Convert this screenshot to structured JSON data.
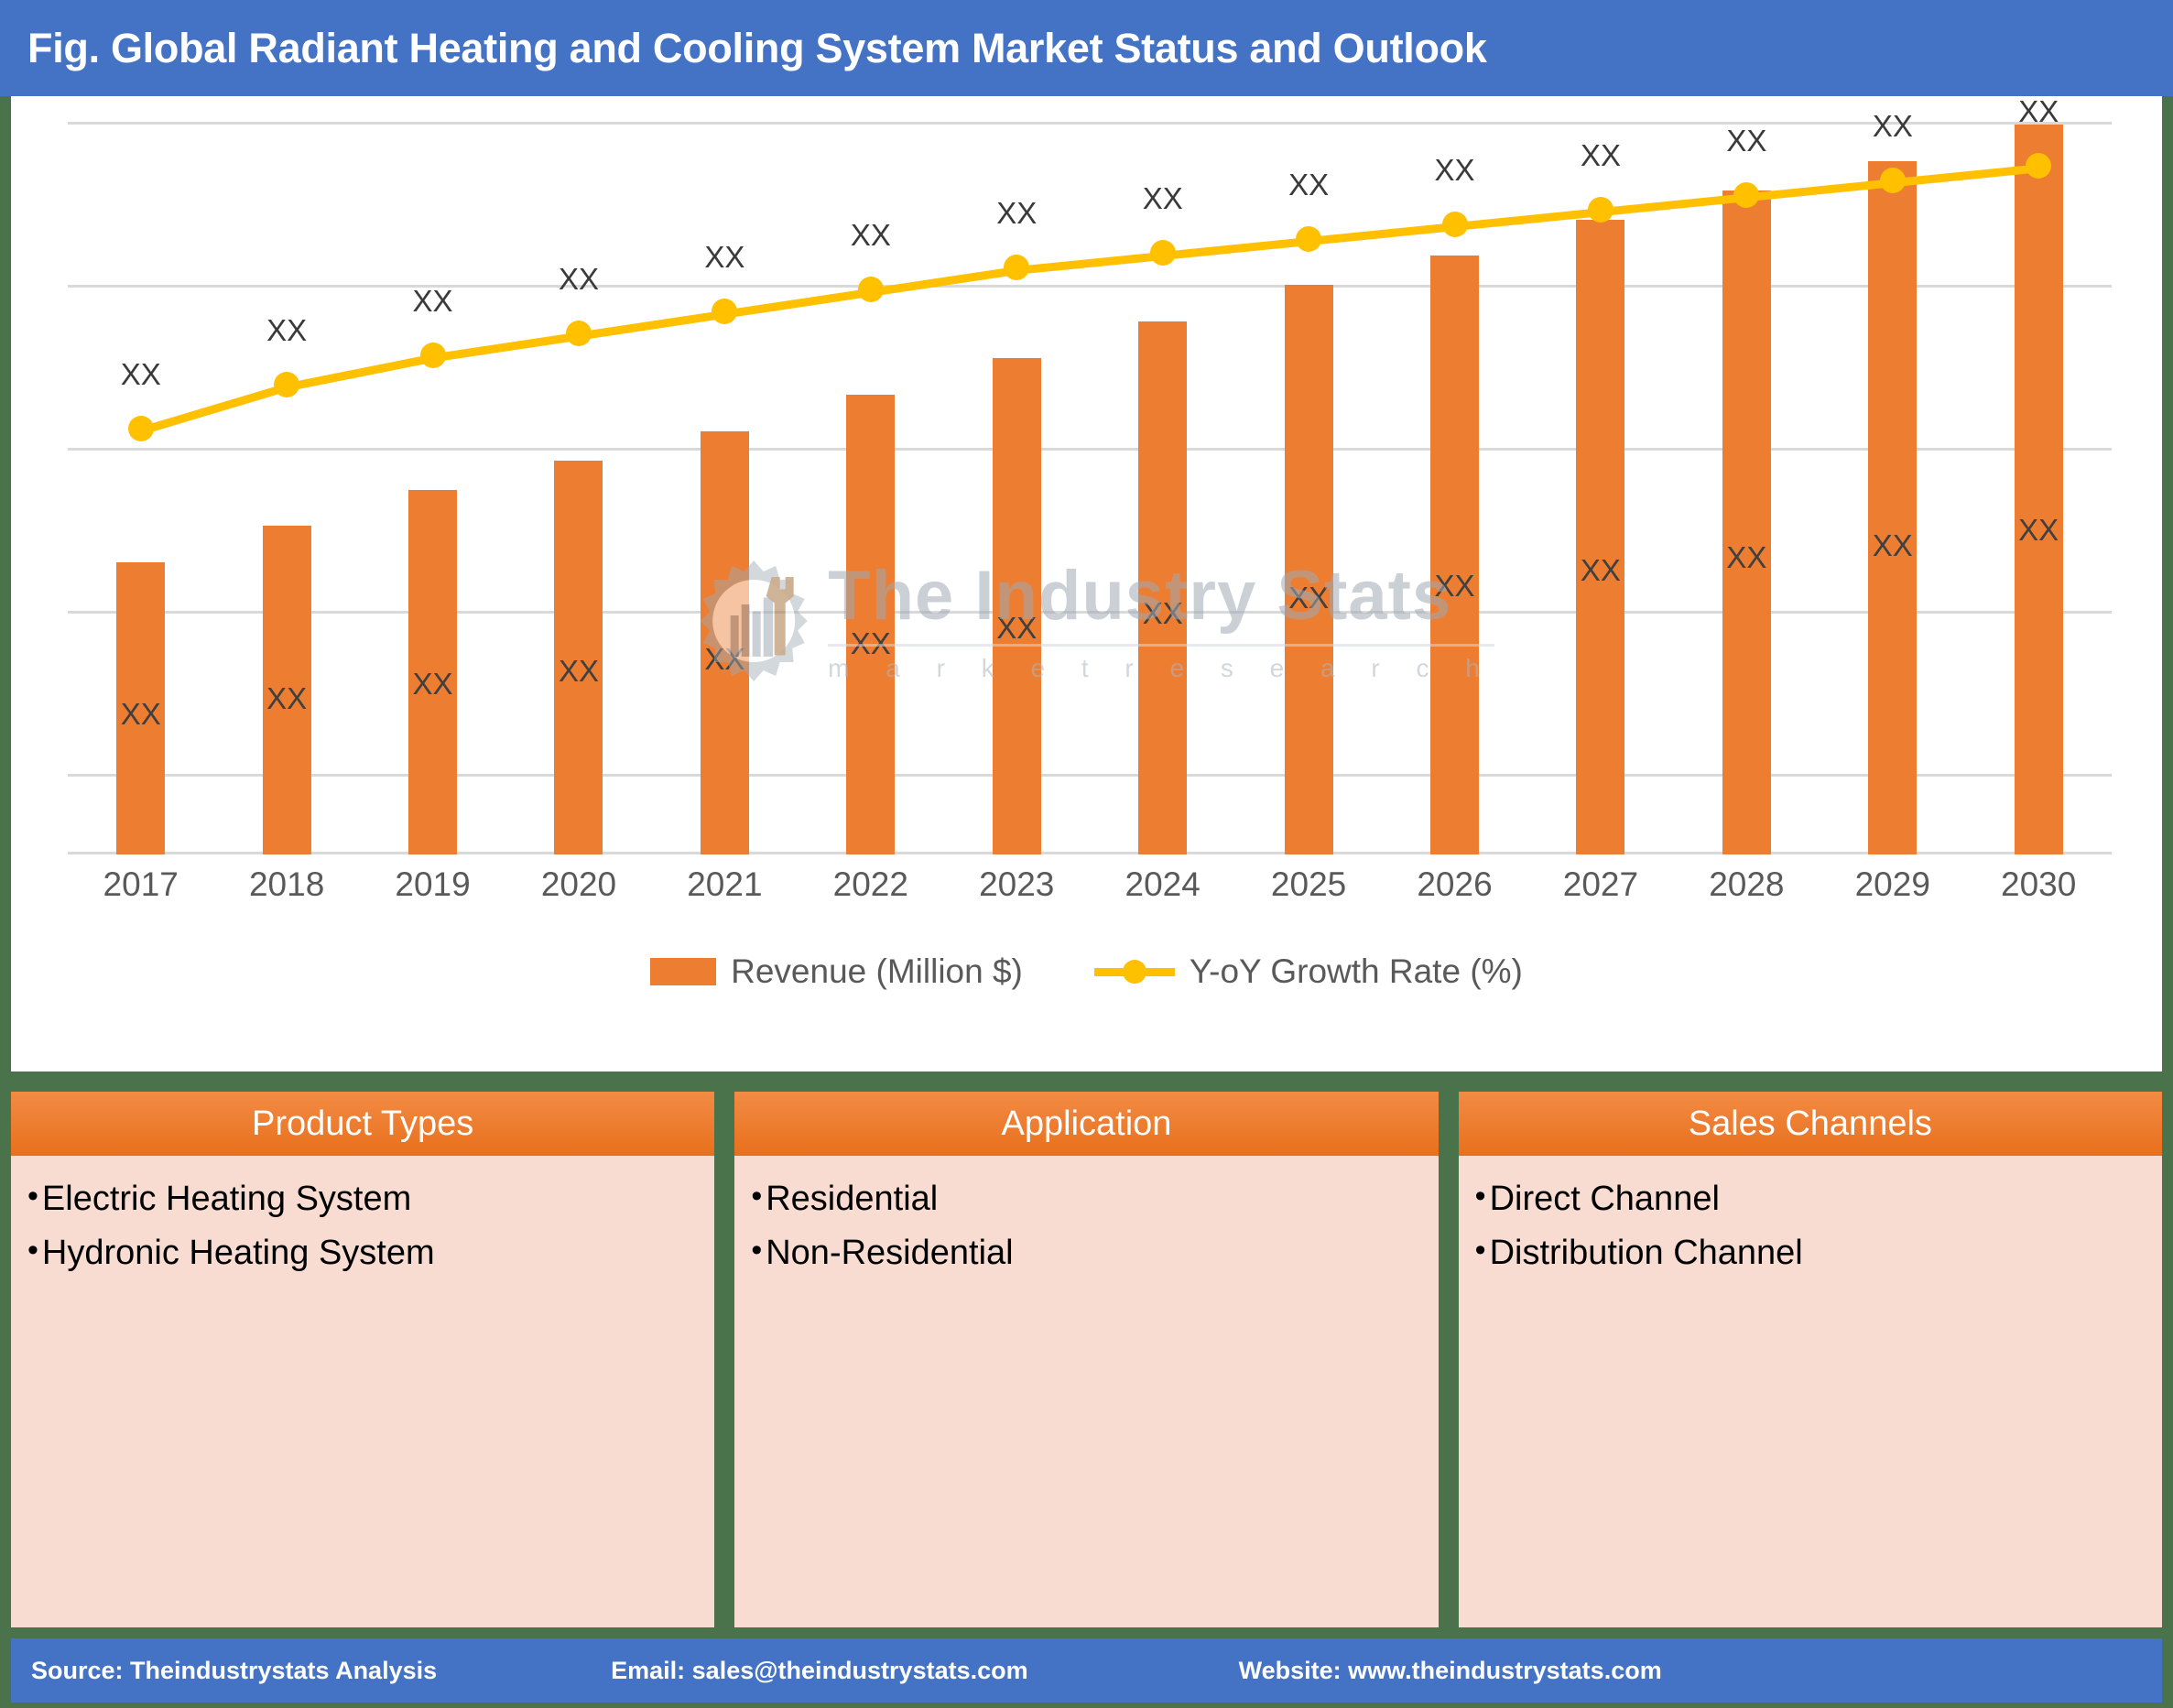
{
  "title": "Fig. Global Radiant Heating and Cooling System Market Status and Outlook",
  "watermark": {
    "main": "The Industry Stats",
    "sub": "m a r k e t   r e s e a r c h",
    "logo_icon": "gear-wrench-factory-icon"
  },
  "legend": {
    "bar_label": "Revenue (Million $)",
    "line_label": "Y-oY Growth Rate (%)"
  },
  "panels": [
    {
      "id": "product-types",
      "title": "Product Types",
      "items": [
        "Electric Heating System",
        "Hydronic Heating System"
      ]
    },
    {
      "id": "application",
      "title": "Application",
      "items": [
        "Residential",
        "Non-Residential"
      ]
    },
    {
      "id": "sales-channels",
      "title": "Sales Channels",
      "items": [
        "Direct Channel",
        "Distribution Channel"
      ]
    }
  ],
  "footer": {
    "source": "Source: Theindustrystats Analysis",
    "email": "Email: sales@theindustrystats.com",
    "website": "Website: www.theindustrystats.com"
  },
  "colors": {
    "title_bar": "#4472C4",
    "bar": "#ED7D31",
    "line": "#FFC000",
    "frame_green": "#4A734C",
    "panel_body": "#F8DCD2",
    "panel_head": "#E8701C",
    "gridline": "#D9D9D9",
    "axis_text": "#595959"
  },
  "chart_data": {
    "type": "bar",
    "title": "Fig. Global Radiant Heating and Cooling System Market Status and Outlook",
    "xlabel": "",
    "ylabel": "",
    "grid": true,
    "legend_position": "bottom",
    "categories": [
      "2017",
      "2018",
      "2019",
      "2020",
      "2021",
      "2022",
      "2023",
      "2024",
      "2025",
      "2026",
      "2027",
      "2028",
      "2029",
      "2030"
    ],
    "ylim": [
      0,
      100
    ],
    "series": [
      {
        "name": "Revenue (Million $)",
        "type": "bar",
        "color": "#ED7D31",
        "values": [
          40,
          45,
          50,
          54,
          58,
          63,
          68,
          73,
          78,
          82,
          87,
          91,
          95,
          100
        ],
        "data_labels": [
          "XX",
          "XX",
          "XX",
          "XX",
          "XX",
          "XX",
          "XX",
          "XX",
          "XX",
          "XX",
          "XX",
          "XX",
          "XX",
          "XX"
        ]
      },
      {
        "name": "Y-oY Growth Rate (%)",
        "type": "line",
        "color": "#FFC000",
        "values": [
          58,
          64,
          68,
          71,
          74,
          77,
          80,
          82,
          84,
          86,
          88,
          90,
          92,
          94
        ],
        "data_labels": [
          "XX",
          "XX",
          "XX",
          "XX",
          "XX",
          "XX",
          "XX",
          "XX",
          "XX",
          "XX",
          "XX",
          "XX",
          "XX",
          "XX"
        ]
      }
    ]
  }
}
